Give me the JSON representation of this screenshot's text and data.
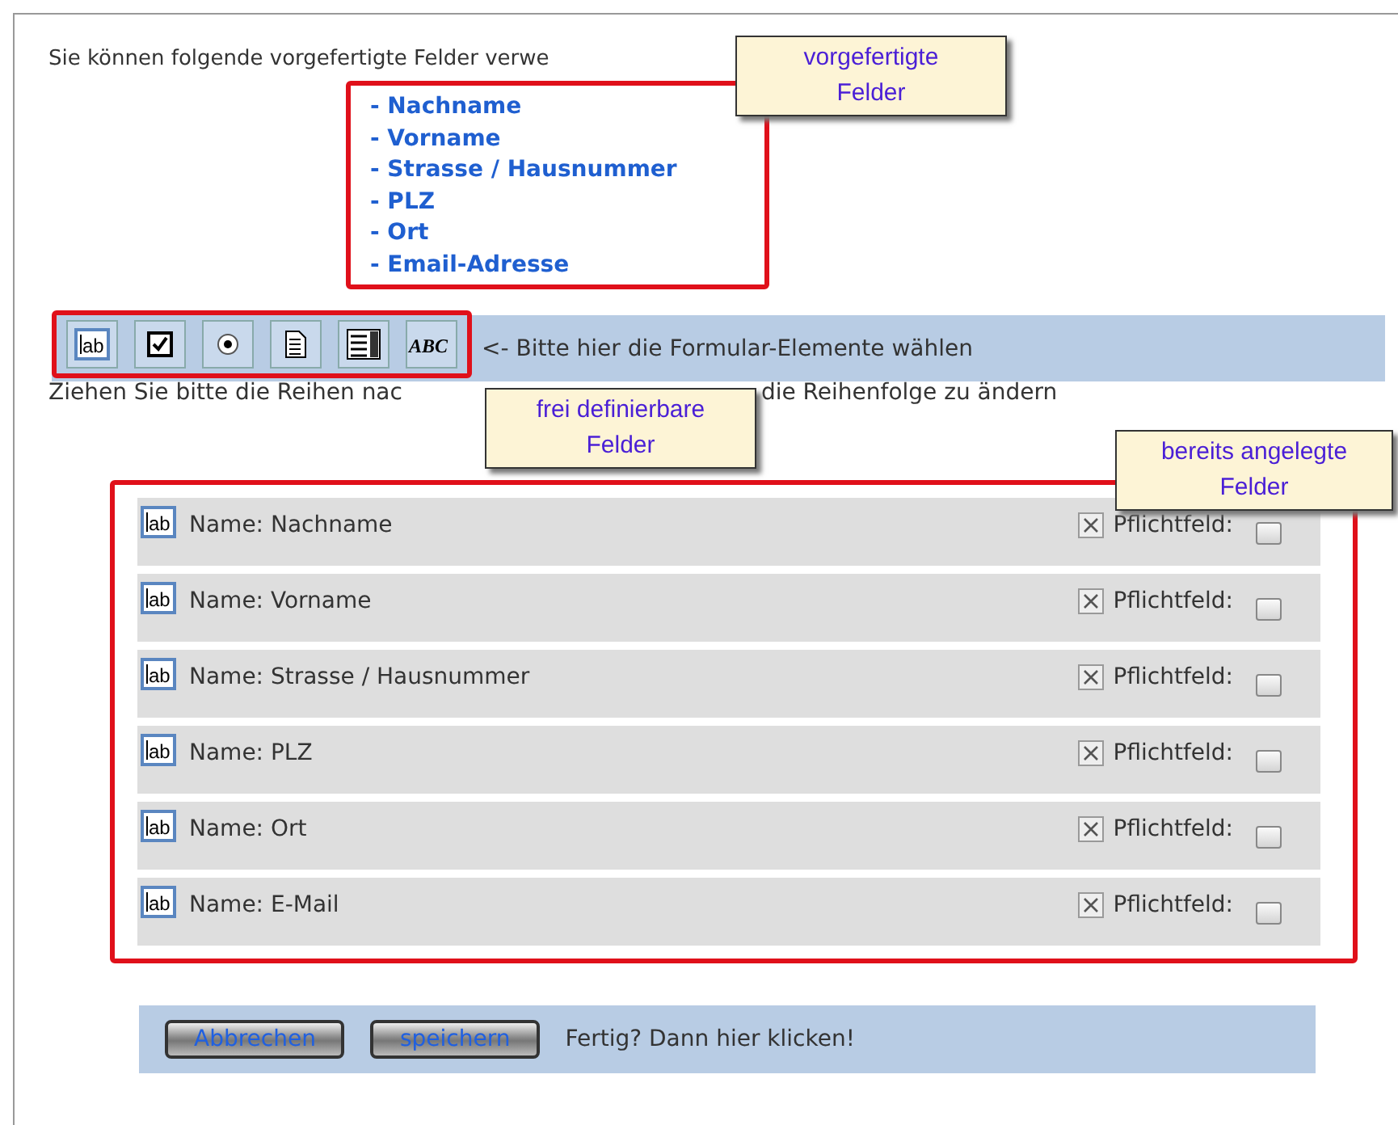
{
  "intro": "Sie können folgende vorgefertigte Felder verwe",
  "predefined_fields": [
    "- Nachname",
    "- Vorname",
    "- Strasse / Hausnummer",
    "- PLZ",
    "- Ort",
    "- Email-Adresse"
  ],
  "toolbar": {
    "tools": [
      {
        "kind": "textfield",
        "label": "ab"
      },
      {
        "kind": "checkbox"
      },
      {
        "kind": "radio"
      },
      {
        "kind": "textarea"
      },
      {
        "kind": "select"
      },
      {
        "kind": "label",
        "label": "ABC"
      }
    ],
    "hint": "<- Bitte hier die Formular-Elemente wählen"
  },
  "instruction": {
    "part_1": "Ziehen Sie bitte die Reihen nac",
    "part_2": "die Reihenfolge zu ändern"
  },
  "rows": [
    {
      "kind": "textfield",
      "label": "ab",
      "name": "Name: Nachname",
      "required_label": "Pflichtfeld:",
      "required": false
    },
    {
      "kind": "textfield",
      "label": "ab",
      "name": "Name: Vorname",
      "required_label": "Pflichtfeld:",
      "required": false
    },
    {
      "kind": "textfield",
      "label": "ab",
      "name": "Name: Strasse / Hausnummer",
      "required_label": "Pflichtfeld:",
      "required": false
    },
    {
      "kind": "textfield",
      "label": "ab",
      "name": "Name: PLZ",
      "required_label": "Pflichtfeld:",
      "required": false
    },
    {
      "kind": "textfield",
      "label": "ab",
      "name": "Name: Ort",
      "required_label": "Pflichtfeld:",
      "required": false
    },
    {
      "kind": "textfield",
      "label": "ab",
      "name": "Name: E-Mail",
      "required_label": "Pflichtfeld:",
      "required": false
    }
  ],
  "footer": {
    "buttons": [
      "Abbrechen",
      "speichern"
    ],
    "hint": "Fertig? Dann hier klicken!"
  },
  "callouts": [
    {
      "text": "vorgefertigte Felder"
    },
    {
      "text": "frei definierbare Felder"
    },
    {
      "text": "bereits angelegte Felder"
    }
  ]
}
